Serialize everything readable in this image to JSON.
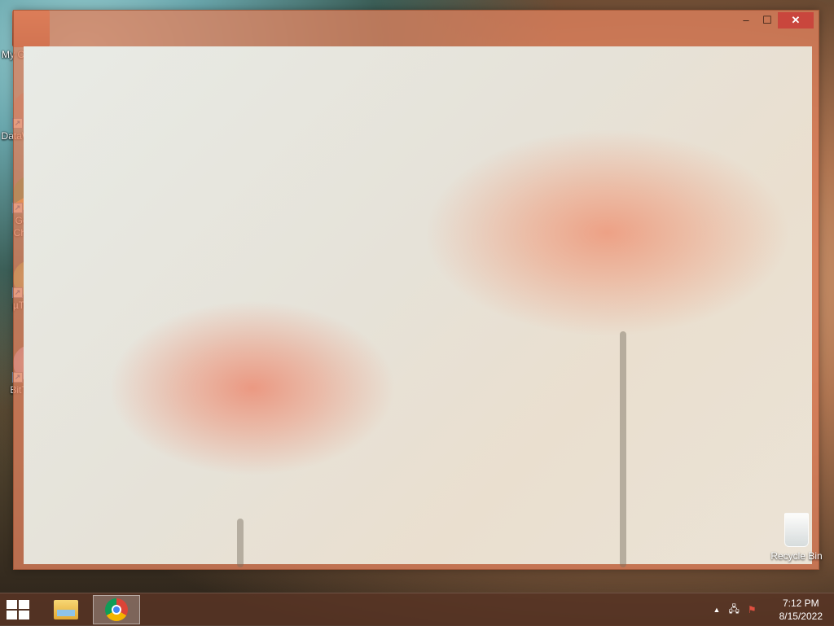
{
  "desktop": {
    "icons": [
      {
        "label": "My Computer",
        "icon": "computer-icon"
      },
      {
        "label": "DataWagon...",
        "icon": "datawagon-icon"
      },
      {
        "label": "Google Chrome",
        "icon": "chrome-icon"
      },
      {
        "label": "µTorrent",
        "icon": "utorrent-icon"
      },
      {
        "label": "BitTorrent",
        "icon": "bittorrent-icon"
      }
    ],
    "recycle_bin": {
      "label": "Recycle Bin",
      "icon": "recycle-bin-icon"
    }
  },
  "window": {
    "controls": {
      "minimize": "–",
      "maximize": "☐",
      "close": "✕"
    }
  },
  "taskbar": {
    "items": [
      {
        "name": "file-explorer",
        "icon": "folder-icon"
      },
      {
        "name": "chrome",
        "icon": "chrome-icon",
        "active": true
      }
    ],
    "tray": {
      "show_hidden": "▲",
      "network": "🖧",
      "action_center": "⚑"
    },
    "clock": {
      "time": "7:12 PM",
      "date": "8/15/2022"
    }
  },
  "colors": {
    "window_frame": "#de805c",
    "close_button": "#c9463d",
    "taskbar": "#583424"
  }
}
